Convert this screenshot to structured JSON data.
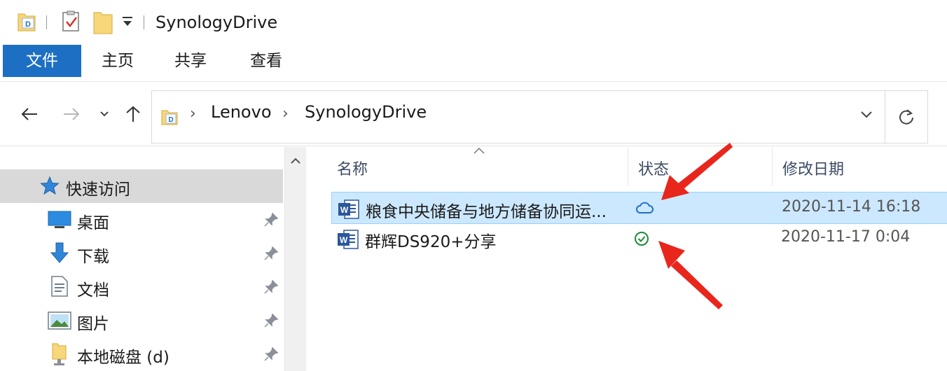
{
  "window": {
    "title": "SynologyDrive"
  },
  "ribbon": {
    "tabs": [
      {
        "label": "文件"
      },
      {
        "label": "主页"
      },
      {
        "label": "共享"
      },
      {
        "label": "查看"
      }
    ]
  },
  "address_bar": {
    "crumbs": [
      "Lenovo",
      "SynologyDrive"
    ]
  },
  "sidebar": {
    "quick_access": "快速访问",
    "items": [
      {
        "label": "桌面",
        "icon": "desktop-icon"
      },
      {
        "label": "下载",
        "icon": "download-icon"
      },
      {
        "label": "文档",
        "icon": "documents-icon"
      },
      {
        "label": "图片",
        "icon": "pictures-icon"
      },
      {
        "label": "本地磁盘 (d)",
        "icon": "local-disk-icon"
      }
    ]
  },
  "file_list": {
    "columns": {
      "name": "名称",
      "status": "状态",
      "modified": "修改日期"
    },
    "rows": [
      {
        "name": "粮食中央储备与地方储备协同运...",
        "status": "cloud-only",
        "modified": "2020-11-14 16:18",
        "selected": true
      },
      {
        "name": "群辉DS920+分享",
        "status": "synced",
        "modified": "2020-11-17 0:04",
        "selected": false
      }
    ]
  },
  "colors": {
    "accent": "#1d6fc4",
    "selection": "#cce8ff",
    "cloud_status": "#1f6fc5",
    "synced_status": "#1e8a3a",
    "annotation_arrow": "#e8261c"
  }
}
